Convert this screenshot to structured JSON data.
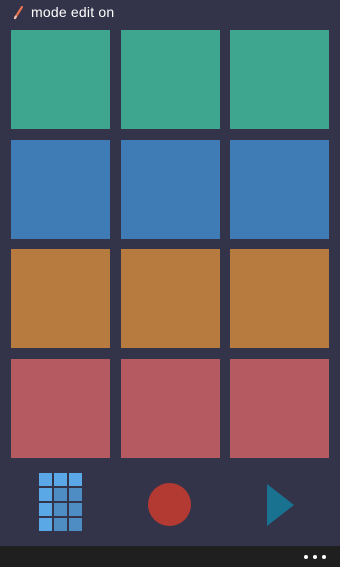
{
  "header": {
    "text": "mode edit on",
    "icon": "pencil-icon"
  },
  "pads": [
    {
      "row": 1,
      "col": 1,
      "color": "#3ea58f"
    },
    {
      "row": 1,
      "col": 2,
      "color": "#3ea58f"
    },
    {
      "row": 1,
      "col": 3,
      "color": "#3ea58f"
    },
    {
      "row": 2,
      "col": 1,
      "color": "#3f7bb5"
    },
    {
      "row": 2,
      "col": 2,
      "color": "#3f7bb5"
    },
    {
      "row": 2,
      "col": 3,
      "color": "#3f7bb5"
    },
    {
      "row": 3,
      "col": 1,
      "color": "#b77a3f"
    },
    {
      "row": 3,
      "col": 2,
      "color": "#b77a3f"
    },
    {
      "row": 3,
      "col": 3,
      "color": "#b77a3f"
    },
    {
      "row": 4,
      "col": 1,
      "color": "#b45a60"
    },
    {
      "row": 4,
      "col": 2,
      "color": "#b45a60"
    },
    {
      "row": 4,
      "col": 3,
      "color": "#b45a60"
    }
  ],
  "controls": {
    "grid_icon": "pad-grid-icon",
    "record_icon": "record-icon",
    "play_icon": "play-icon",
    "record_color": "#b23a33",
    "play_color": "#1a7291"
  },
  "appbar": {
    "more_icon": "more-dots-icon"
  },
  "colors": {
    "background": "#33334a",
    "appbar": "#1f1f1f",
    "text": "#ffffff"
  }
}
